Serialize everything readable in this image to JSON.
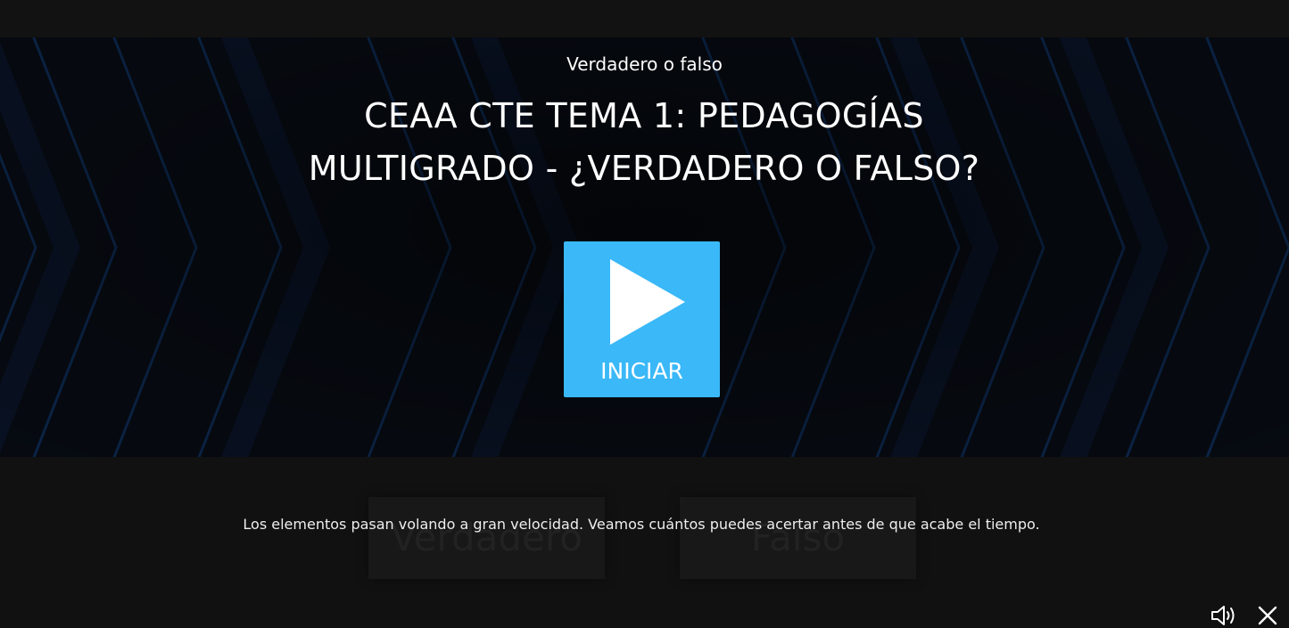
{
  "activity": {
    "type_label": "Verdadero o falso",
    "title_line1": "CEAA CTE TEMA 1: PEDAGOGÍAS",
    "title_line2": "MULTIGRADO - ¿VERDADERO O FALSO?"
  },
  "start_button": {
    "label": "INICIAR",
    "icon": "play-icon",
    "color": "#3ab8f8"
  },
  "answers": {
    "true_label": "Verdadero",
    "false_label": "Falso"
  },
  "instructions": "Los elementos pasan volando a gran velocidad. Veamos cuántos puedes acertar antes de que acabe el tiempo.",
  "controls": {
    "sound_icon": "speaker-icon",
    "close_icon": "close-icon"
  },
  "theme": {
    "background": "#111111",
    "hero_background": "#070b12",
    "chevron_color": "#0d2a52"
  }
}
